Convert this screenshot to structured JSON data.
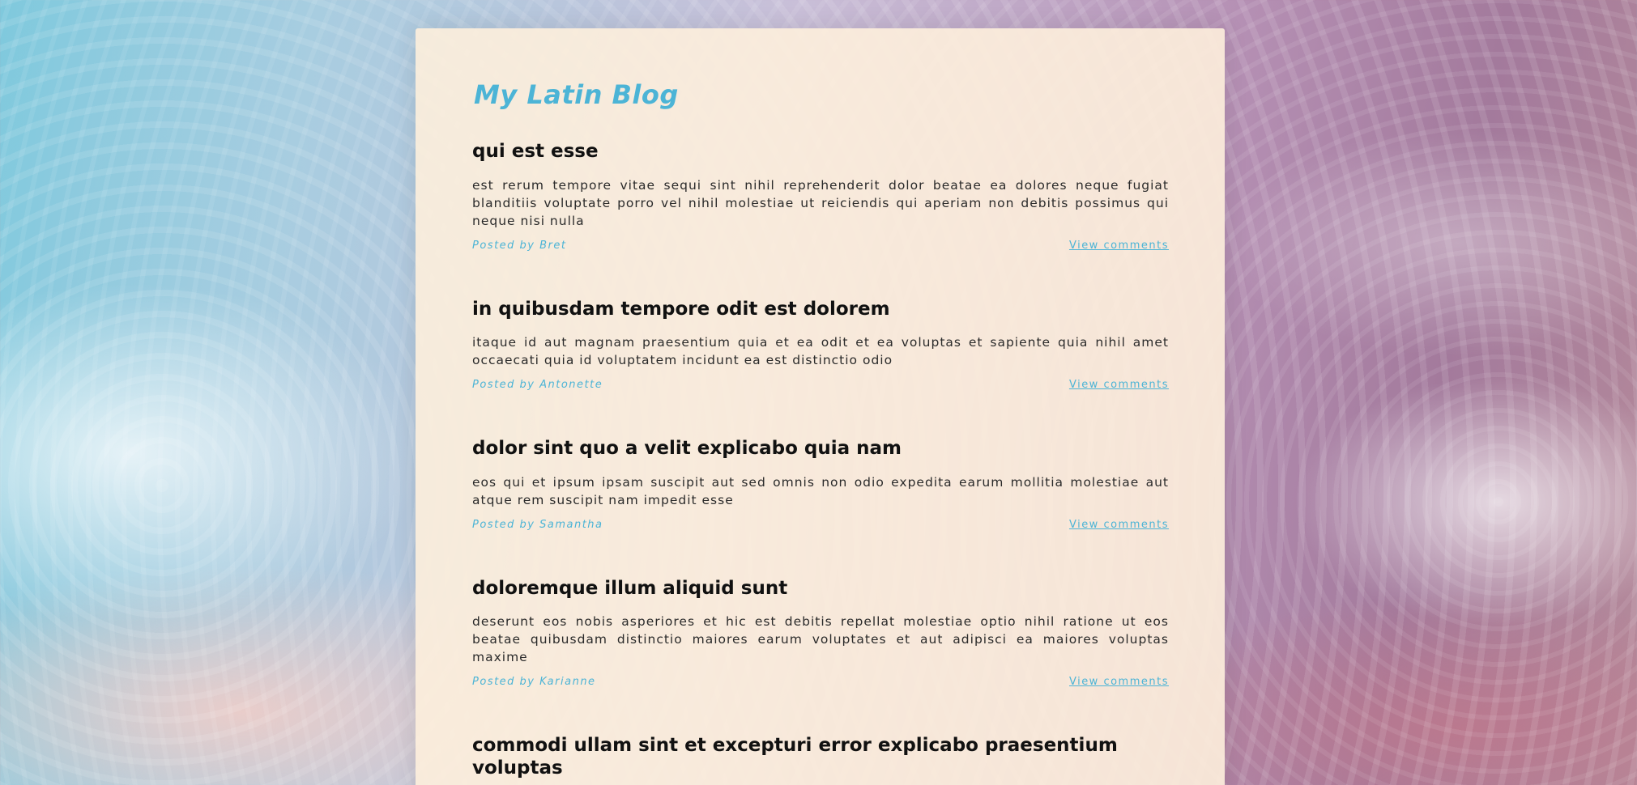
{
  "blog": {
    "title": "My Latin Blog"
  },
  "posts": [
    {
      "title": "qui est esse",
      "body": "est rerum tempore vitae sequi sint nihil reprehenderit dolor beatae ea dolores neque fugiat blanditiis voluptate porro vel nihil molestiae ut reiciendis qui aperiam non debitis possimus qui neque nisi nulla",
      "author": "Posted by Bret",
      "comments_link": "View comments"
    },
    {
      "title": "in quibusdam tempore odit est dolorem",
      "body": "itaque id aut magnam praesentium quia et ea odit et ea voluptas et sapiente quia nihil amet occaecati quia id voluptatem incidunt ea est distinctio odio",
      "author": "Posted by Antonette",
      "comments_link": "View comments"
    },
    {
      "title": "dolor sint quo a velit explicabo quia nam",
      "body": "eos qui et ipsum ipsam suscipit aut sed omnis non odio expedita earum mollitia molestiae aut atque rem suscipit nam impedit esse",
      "author": "Posted by Samantha",
      "comments_link": "View comments"
    },
    {
      "title": "doloremque illum aliquid sunt",
      "body": "deserunt eos nobis asperiores et hic est debitis repellat molestiae optio nihil ratione ut eos beatae quibusdam distinctio maiores earum voluptates et aut adipisci ea maiores voluptas maxime",
      "author": "Posted by Karianne",
      "comments_link": "View comments"
    },
    {
      "title": "commodi ullam sint et excepturi error explicabo praesentium voluptas"
    }
  ],
  "colors": {
    "accent": "#4cb4d6",
    "card_background": "#fdeedc",
    "heading_text": "#111111"
  }
}
